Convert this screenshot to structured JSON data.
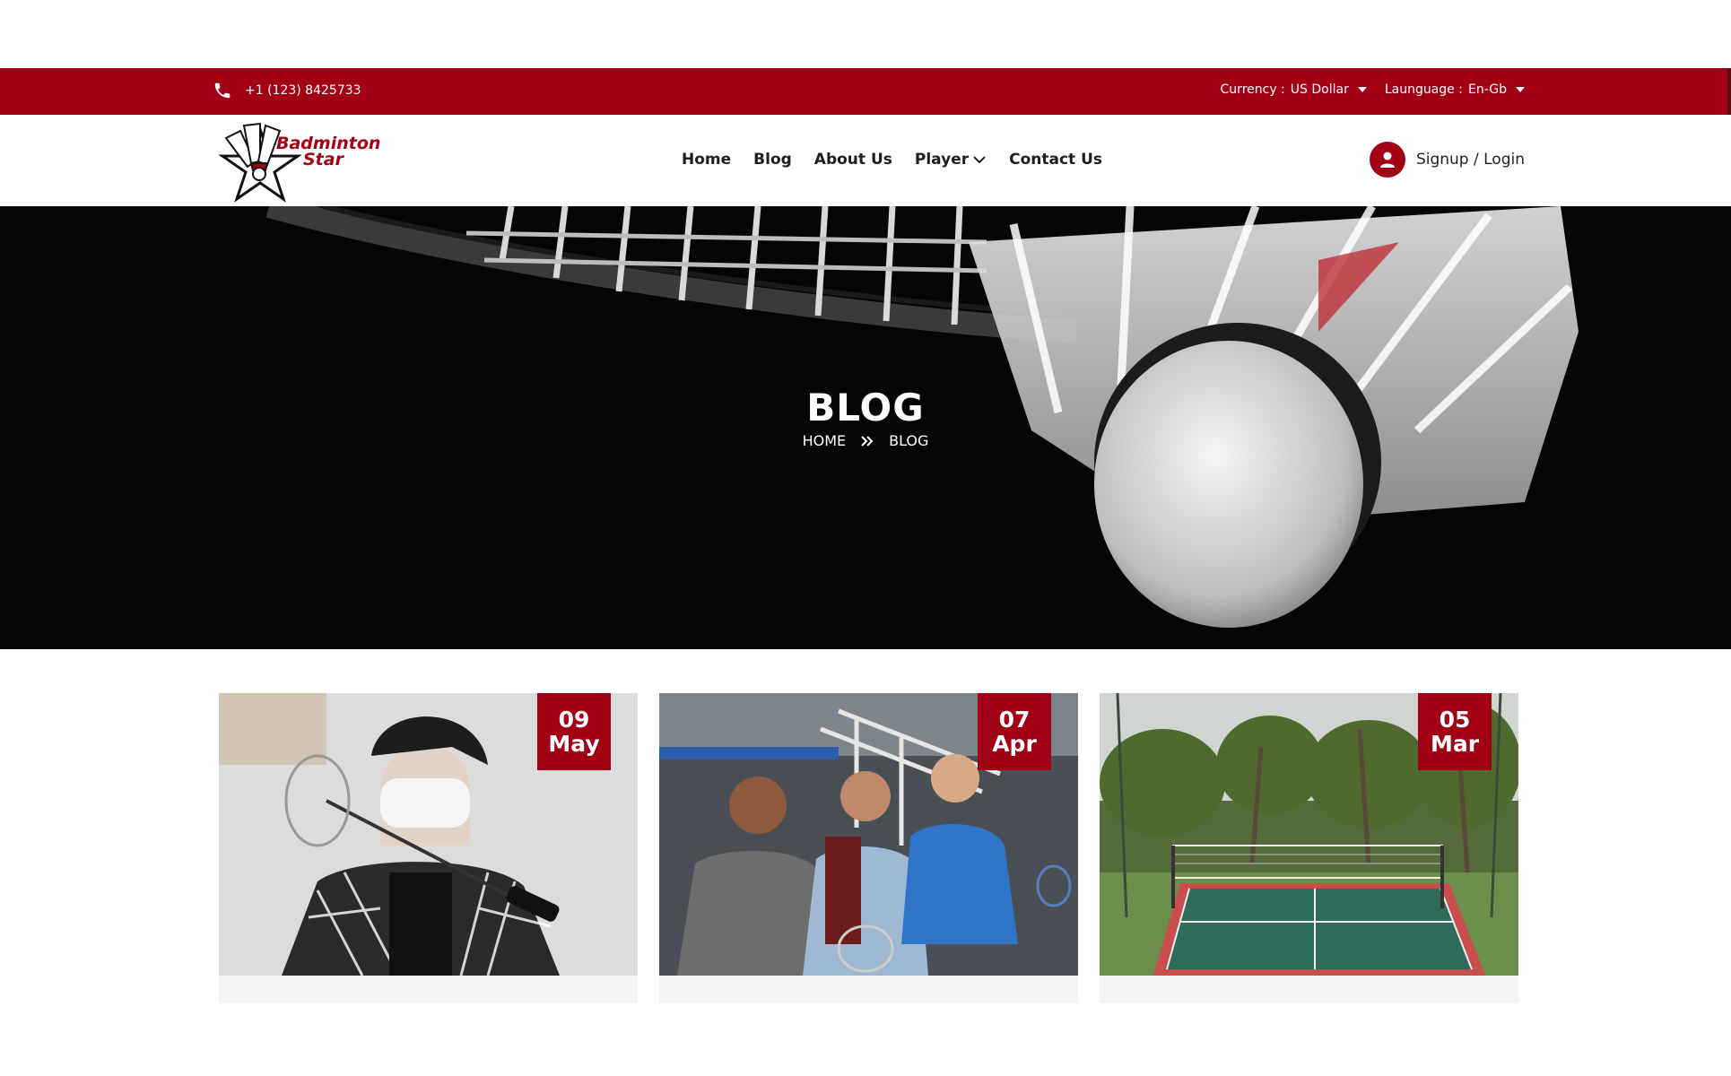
{
  "topbar": {
    "phone": "+1 (123) 8425733",
    "currency_label": "Currency :",
    "currency_value": "US Dollar",
    "language_label": "Lаunguage :",
    "language_value": "En-Gb"
  },
  "logo": {
    "line1": "Badminton",
    "line2": "Star"
  },
  "nav": {
    "items": [
      "Home",
      "Blog",
      "About Us",
      "Player",
      "Contact Us"
    ]
  },
  "account": {
    "label": "Signup / Login"
  },
  "hero": {
    "title": "BLOG",
    "breadcrumb": [
      "HOME",
      "BLOG"
    ]
  },
  "posts": [
    {
      "day": "09",
      "month": "May"
    },
    {
      "day": "07",
      "month": "Apr"
    },
    {
      "day": "05",
      "month": "Mar"
    }
  ],
  "colors": {
    "brand": "#a10015",
    "text": "#222222"
  },
  "icons": [
    "phone-icon",
    "chevron-down-icon",
    "user-icon",
    "double-chevron-right-icon"
  ]
}
